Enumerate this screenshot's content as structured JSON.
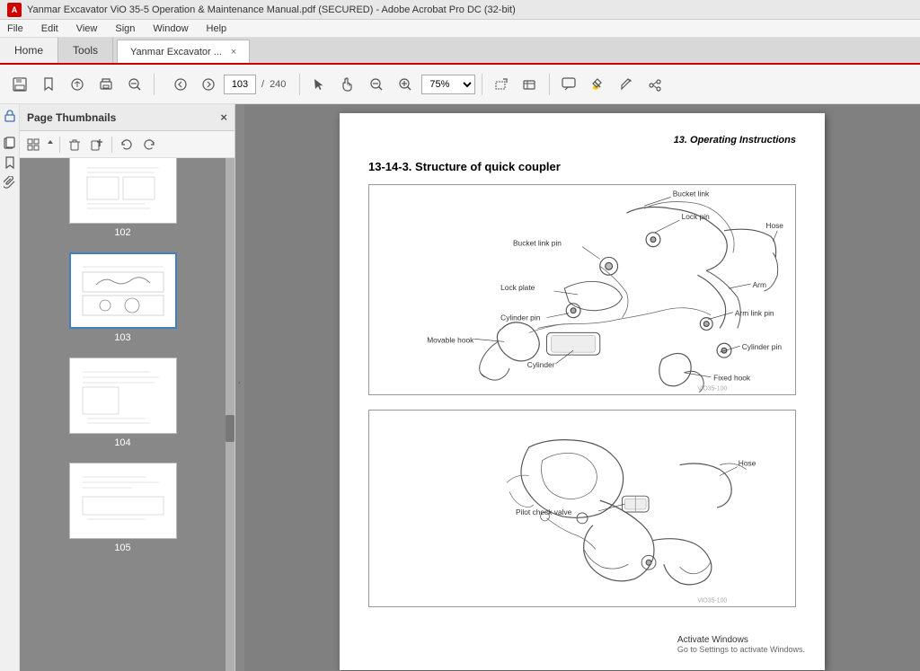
{
  "window": {
    "title": "Yanmar Excavator ViO 35-5 Operation & Maintenance Manual.pdf (SECURED) - Adobe Acrobat Pro DC (32-bit)",
    "icon_label": "A"
  },
  "menubar": {
    "items": [
      "File",
      "Edit",
      "View",
      "Sign",
      "Window",
      "Help"
    ]
  },
  "tabs": {
    "home_label": "Home",
    "tools_label": "Tools",
    "doc_label": "Yanmar Excavator ...",
    "close_symbol": "×"
  },
  "toolbar": {
    "page_current": "103",
    "page_total": "240",
    "zoom_level": "75%",
    "nav_up_label": "▲",
    "nav_down_label": "▼"
  },
  "panel": {
    "title": "Page Thumbnails",
    "close_symbol": "×",
    "thumbnails": [
      {
        "id": 1,
        "page_num": "102",
        "active": false
      },
      {
        "id": 2,
        "page_num": "103",
        "active": true
      },
      {
        "id": 3,
        "page_num": "104",
        "active": false
      },
      {
        "id": 4,
        "page_num": "105",
        "active": false
      }
    ]
  },
  "content": {
    "header_text": "13. Operating Instructions",
    "section_title": "13-14-3. Structure of quick coupler",
    "diagram1": {
      "labels": [
        "Bucket link",
        "Lock pin",
        "Hose",
        "Bucket link pin",
        "Lock plate",
        "Arm",
        "Cylinder pin",
        "Arm link pin",
        "Movable hook",
        "Cylinder pin",
        "Cylinder",
        "Fixed hook"
      ],
      "watermark": "ViO35-100"
    },
    "diagram2": {
      "labels": [
        "Hose",
        "Pilot check valve"
      ],
      "watermark": "ViO35-100"
    }
  },
  "watermark": {
    "title": "Activate Windows",
    "subtitle": "Go to Settings to activate Windows."
  },
  "colors": {
    "accent_blue": "#4080c0",
    "toolbar_bg": "#f5f5f5",
    "panel_bg": "#888888",
    "page_bg": "#ffffff",
    "tab_active": "#cc0000"
  }
}
